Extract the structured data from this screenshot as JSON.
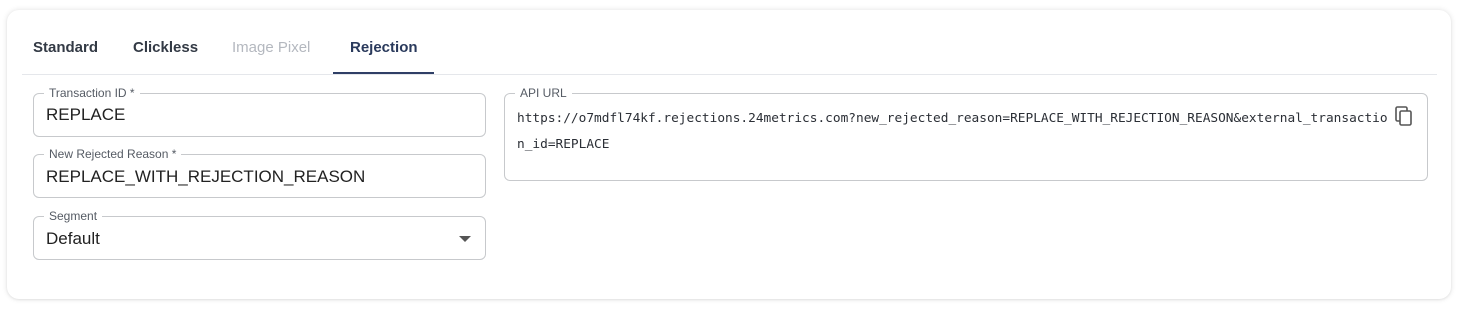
{
  "tabs": [
    {
      "label": "Standard"
    },
    {
      "label": "Clickless"
    },
    {
      "label": "Image Pixel"
    },
    {
      "label": "Rejection"
    }
  ],
  "transaction_id": {
    "label": "Transaction ID *",
    "value": "REPLACE"
  },
  "rejected_reason": {
    "label": "New Rejected Reason *",
    "value": "REPLACE_WITH_REJECTION_REASON"
  },
  "segment": {
    "label": "Segment",
    "value": "Default"
  },
  "api_url": {
    "label": "API URL",
    "value": "https://o7mdfl74kf.rejections.24metrics.com?new_rejected_reason=REPLACE_WITH_REJECTION_REASON&external_transaction_id=REPLACE",
    "copy_icon": "copy-icon"
  }
}
